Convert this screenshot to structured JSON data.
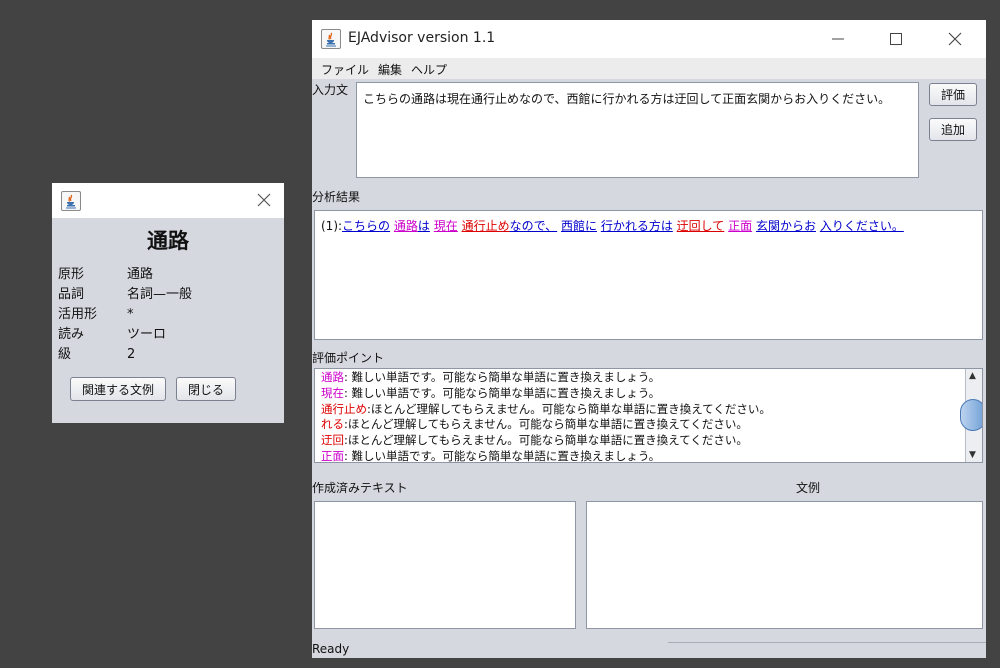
{
  "colors": {
    "link_blue": "#0000cc",
    "magenta": "#cc00cc",
    "red": "#dd0000",
    "panel": "#d5d8df"
  },
  "popup": {
    "icon": "java-icon",
    "close_icon": "close-icon",
    "word": "通路",
    "rows": [
      {
        "label": "原形",
        "value": "通路"
      },
      {
        "label": "品詞",
        "value": "名詞—一般"
      },
      {
        "label": "活用形",
        "value": "*"
      },
      {
        "label": "読み",
        "value": "ツーロ"
      },
      {
        "label": "級",
        "value": "2"
      }
    ],
    "related_button": "関連する文例",
    "close_button": "閉じる"
  },
  "main": {
    "icon": "java-icon",
    "title": "EJAdvisor version 1.1",
    "menu": [
      "ファイル",
      "編集",
      "ヘルプ"
    ],
    "input_label": "入力文",
    "input_text": "こちらの通路は現在通行止めなので、西館に行かれる方は迂回して正面玄関からお入りください。",
    "evaluate_button": "評価",
    "add_button": "追加",
    "analysis_label": "分析結果",
    "analysis_prefix": "(1):",
    "analysis_tokens": [
      {
        "text": "こちらの",
        "color": "blue",
        "underline": true
      },
      {
        "text": " ",
        "color": "none",
        "underline": false
      },
      {
        "text": "通路",
        "color": "magenta",
        "underline": true
      },
      {
        "text": "は",
        "color": "blue",
        "underline": true
      },
      {
        "text": " ",
        "color": "none",
        "underline": false
      },
      {
        "text": "現在",
        "color": "magenta",
        "underline": true
      },
      {
        "text": " ",
        "color": "none",
        "underline": false
      },
      {
        "text": "通行止め",
        "color": "red",
        "underline": true
      },
      {
        "text": "なので、",
        "color": "blue",
        "underline": true
      },
      {
        "text": " ",
        "color": "none",
        "underline": false
      },
      {
        "text": "西館に",
        "color": "blue",
        "underline": true
      },
      {
        "text": " ",
        "color": "none",
        "underline": false
      },
      {
        "text": "行かれる方は",
        "color": "blue",
        "underline": true
      },
      {
        "text": " ",
        "color": "none",
        "underline": false
      },
      {
        "text": "迂回して",
        "color": "red",
        "underline": true
      },
      {
        "text": " ",
        "color": "none",
        "underline": false
      },
      {
        "text": "正面",
        "color": "magenta",
        "underline": true
      },
      {
        "text": " ",
        "color": "none",
        "underline": false
      },
      {
        "text": "玄関からお",
        "color": "blue",
        "underline": true
      },
      {
        "text": " ",
        "color": "none",
        "underline": false
      },
      {
        "text": "入りください。",
        "color": "blue",
        "underline": true
      }
    ],
    "eval_label": "評価ポイント",
    "eval_points": [
      {
        "term": "通路",
        "color": "magenta",
        "message": ": 難しい単語です。可能なら簡単な単語に置き換えましょう。"
      },
      {
        "term": "現在",
        "color": "magenta",
        "message": ": 難しい単語です。可能なら簡単な単語に置き換えましょう。"
      },
      {
        "term": "通行止め",
        "color": "red",
        "message": ":ほとんど理解してもらえません。可能なら簡単な単語に置き換えてください。"
      },
      {
        "term": "れる",
        "color": "red",
        "message": ":ほとんど理解してもらえません。可能なら簡単な単語に置き換えてください。"
      },
      {
        "term": "迂回",
        "color": "red",
        "message": ":ほとんど理解してもらえません。可能なら簡単な単語に置き換えてください。"
      },
      {
        "term": "正面",
        "color": "magenta",
        "message": ": 難しい単語です。可能なら簡単な単語に置き換えましょう。"
      }
    ],
    "created_text_label": "作成済みテキスト",
    "examples_label": "文例",
    "status": "Ready"
  }
}
